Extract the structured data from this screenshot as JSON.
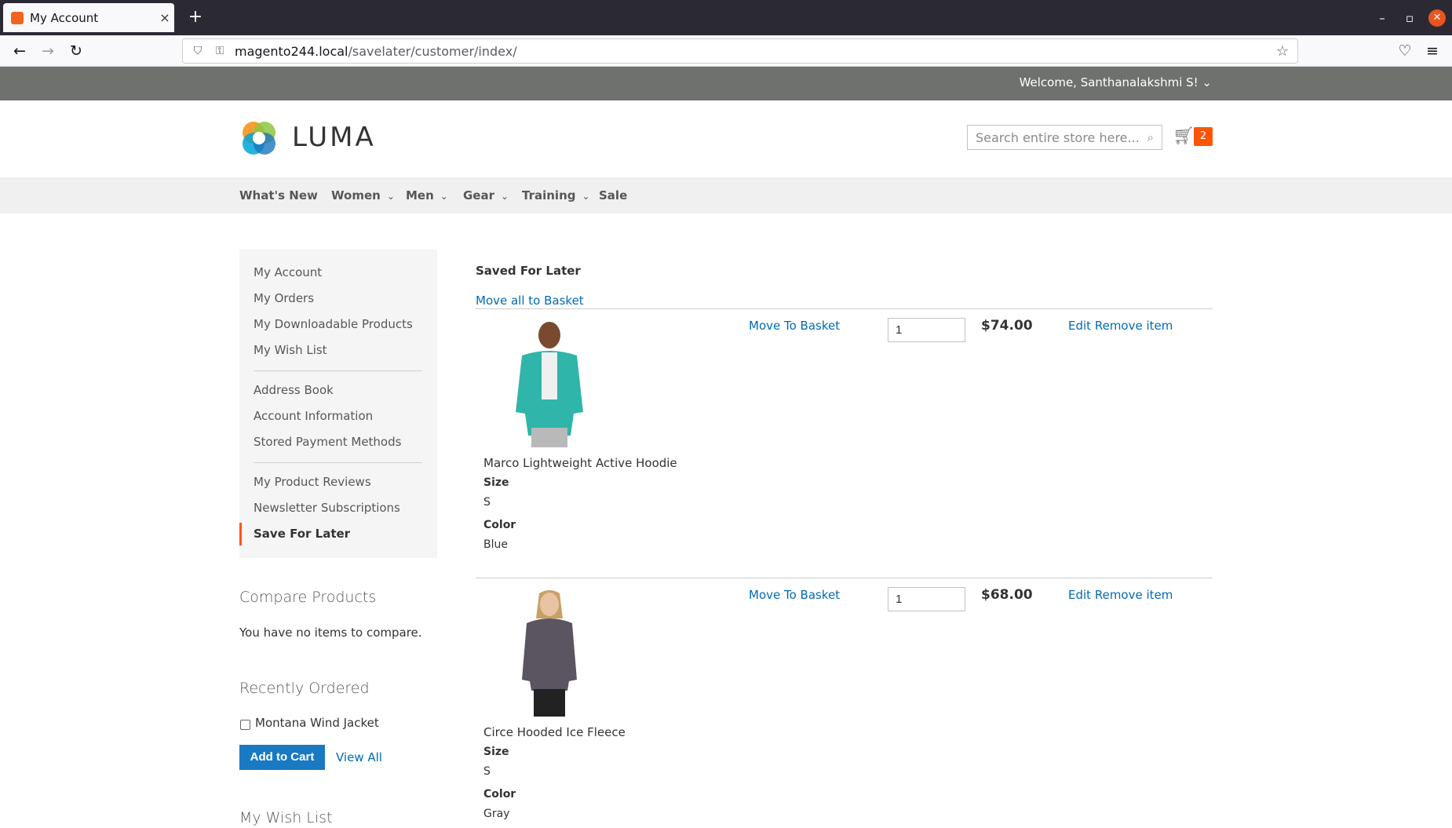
{
  "browser": {
    "tab_title": "My Account",
    "tab_close": "×",
    "new_tab": "+",
    "url_host": "magento244.local",
    "url_path": "/savelater/customer/index/"
  },
  "header": {
    "welcome": "Welcome, Santhanalakshmi S! ⌄",
    "logo_text": "LUMA",
    "search_placeholder": "Search entire store here...",
    "cart_count": "2"
  },
  "nav": {
    "items": [
      {
        "label": "What's New"
      },
      {
        "label": "Women"
      },
      {
        "label": "Men"
      },
      {
        "label": "Gear"
      },
      {
        "label": "Training"
      },
      {
        "label": "Sale"
      }
    ]
  },
  "sidebar": {
    "group1": [
      "My Account",
      "My Orders",
      "My Downloadable Products",
      "My Wish List"
    ],
    "group2": [
      "Address Book",
      "Account Information",
      "Stored Payment Methods"
    ],
    "group3": [
      "My Product Reviews",
      "Newsletter Subscriptions",
      "Save For Later"
    ]
  },
  "compare": {
    "title": "Compare Products",
    "text": "You have no items to compare."
  },
  "recently_ordered": {
    "title": "Recently Ordered",
    "item": "Montana Wind Jacket",
    "add_to_cart": "Add to Cart",
    "view_all": "View All"
  },
  "wishlist_block": {
    "title": "My Wish List"
  },
  "main": {
    "heading": "Saved For Later",
    "move_all": "Move all to Basket",
    "size_label": "Size",
    "color_label": "Color",
    "move_to_basket": "Move To Basket",
    "edit": "Edit",
    "remove": "Remove item",
    "products": [
      {
        "name": "Marco Lightweight Active Hoodie",
        "size": "S",
        "color": "Blue",
        "qty": "1",
        "price": "$74.00",
        "swatch": "#2fb5a9"
      },
      {
        "name": "Circe Hooded Ice Fleece",
        "size": "S",
        "color": "Gray",
        "qty": "1",
        "price": "$68.00",
        "swatch": "#5a5560"
      }
    ]
  }
}
